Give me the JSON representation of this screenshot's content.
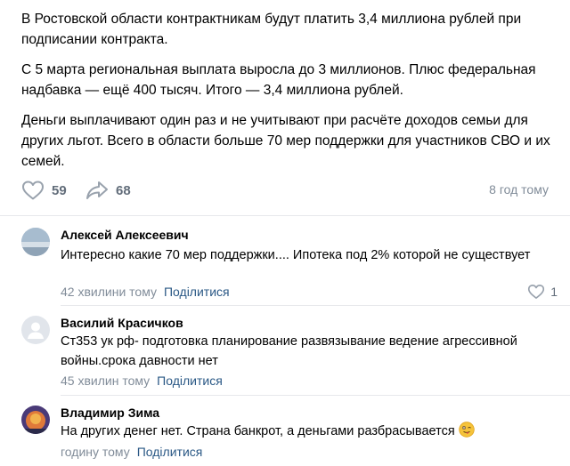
{
  "post": {
    "paragraphs": [
      "В Ростовской области контрактникам будут платить 3,4 миллиона рублей при подписании контракта.",
      "С 5 марта региональная выплата выросла до 3 миллионов. Плюс федеральная надбавка — ещё 400 тысяч. Итого — 3,4 миллиона рублей.",
      "Деньги выплачивают один раз и не учитывают при расчёте доходов семьи для других льгот. Всего в области больше 70 мер поддержки для участников СВО и их семей."
    ],
    "likes": "59",
    "shares": "68",
    "time": "8 год тому"
  },
  "comments": [
    {
      "author": "Алексей Алексеевич",
      "text": "Интересно какие 70 мер поддержки.... Ипотека под 2% которой не существует",
      "time": "42 хвилини тому",
      "share_label": "Поділитися",
      "likes": "1",
      "avatar": "photo-avatar"
    },
    {
      "author": "Василий Красичков",
      "text": "Ст353 ук рф- подготовка планирование развязывание ведение агрессивной войны.срока давности нет",
      "time": "45 хвилин тому",
      "share_label": "Поділитися",
      "avatar": "default-avatar"
    },
    {
      "author": "Владимир Зима",
      "text": "На других денег нет. Страна банкрот, а деньгами разбрасывается",
      "time": "годину тому",
      "share_label": "Поділитися",
      "avatar": "photo-avatar",
      "emoji": "winking-tongue-emoji"
    }
  ],
  "colors": {
    "link": "#2a5885",
    "secondary": "#818c99",
    "icon": "#99a2ad",
    "divider": "#e7e8ec"
  }
}
